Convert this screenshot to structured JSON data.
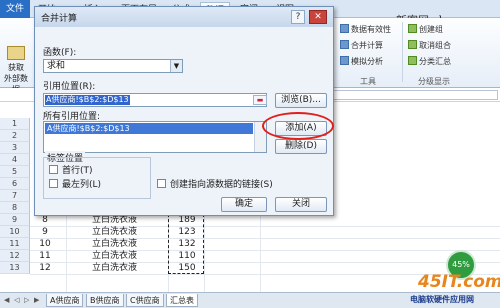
{
  "ribbon": {
    "tabs": [
      "文件",
      "开始",
      "插入",
      "页面布局",
      "公式",
      "数据",
      "审阅",
      "视图"
    ],
    "active_tab": "数据",
    "fetch_label_1": "获取",
    "fetch_label_2": "外部数据",
    "items": {
      "data_validation": "数据有效性",
      "consolidate": "合并计算",
      "what_if": "模拟分析",
      "group": "创建组",
      "ungroup": "取消组合",
      "subtotal": "分类汇总",
      "tools_label": "工具",
      "outline_label": "分级显示"
    }
  },
  "grid": {
    "row_headers": [
      "1",
      "2",
      "3",
      "4",
      "5",
      "6",
      "7",
      "8",
      "9",
      "10",
      "11",
      "12",
      "13"
    ],
    "data_rows": [
      {
        "num": "8",
        "product": "立白洗衣液",
        "qty": "189"
      },
      {
        "num": "9",
        "product": "立白洗衣液",
        "qty": "123"
      },
      {
        "num": "10",
        "product": "立白洗衣液",
        "qty": "132"
      },
      {
        "num": "11",
        "product": "立白洗衣液",
        "qty": "110"
      },
      {
        "num": "12",
        "product": "立白洗衣液",
        "qty": "150"
      }
    ]
  },
  "sheets": [
    "A供应商",
    "B供应商",
    "C供应商",
    "汇总表"
  ],
  "active_sheet": "汇总表",
  "dialog": {
    "title": "合并计算",
    "help": "?",
    "close": "✕",
    "function_label": "函数(F):",
    "function_value": "求和",
    "ref_label": "引用位置(R):",
    "ref_value": "A供应商!$B$2:$D$13",
    "browse_button": "浏览(B)...",
    "all_refs_label": "所有引用位置:",
    "all_refs": [
      "A供应商!$B$2:$D$13"
    ],
    "add_button": "添加(A)",
    "delete_button": "删除(D)",
    "label_position": "标签位置",
    "top_row": "首行(T)",
    "left_column": "最左列(L)",
    "create_links": "创建指向源数据的链接(S)",
    "ok_button": "确定",
    "close_button": "关闭"
  },
  "watermarks": {
    "top": "新客网 xker.com",
    "logo": "45IT.com",
    "sub": "电脑软硬件应用网",
    "badge": "45%"
  },
  "colors": {
    "accent": "#2a6fc6",
    "highlight": "#e0201b",
    "selection": "#3f78d6"
  }
}
